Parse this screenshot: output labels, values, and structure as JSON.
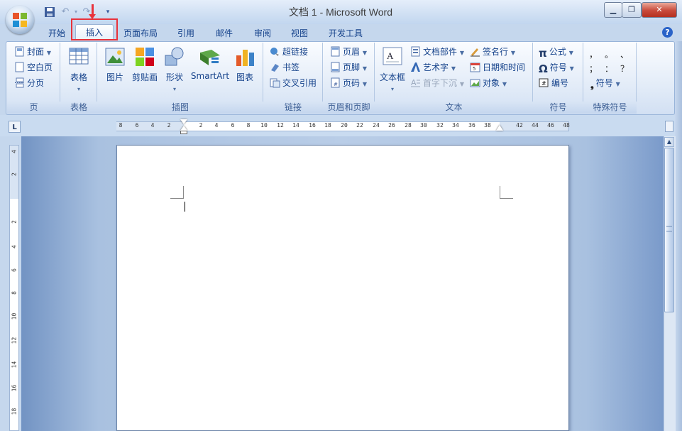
{
  "window": {
    "title": "文档 1 - Microsoft Word",
    "minimize": "▁",
    "restore": "❐",
    "close": "✕"
  },
  "quick_access": {
    "save_icon": "save-icon",
    "undo_icon": "undo-icon",
    "redo_icon": "redo-icon",
    "customize_icon": "customize-qat-icon"
  },
  "tabs": [
    "开始",
    "插入",
    "页面布局",
    "引用",
    "邮件",
    "审阅",
    "视图",
    "开发工具"
  ],
  "active_tab": "插入",
  "help": "?",
  "ribbon": {
    "pages": {
      "label": "页",
      "items": [
        "封面",
        "空白页",
        "分页"
      ]
    },
    "tables": {
      "label": "表格",
      "button": "表格"
    },
    "illustrations": {
      "label": "插图",
      "items": [
        "图片",
        "剪贴画",
        "形状",
        "SmartArt",
        "图表"
      ]
    },
    "links": {
      "label": "链接",
      "items": [
        "超链接",
        "书签",
        "交叉引用"
      ]
    },
    "header_footer": {
      "label": "页眉和页脚",
      "items": [
        "页眉",
        "页脚",
        "页码"
      ]
    },
    "text": {
      "label": "文本",
      "textbox": "文本框",
      "items": [
        "文档部件",
        "艺术字",
        "首字下沉",
        "签名行",
        "日期和时间",
        "对象"
      ]
    },
    "symbols": {
      "label": "符号",
      "items": [
        "公式",
        "符号",
        "编号"
      ]
    },
    "special_symbols": {
      "label": "特殊符号",
      "chars": [
        "，",
        "。",
        "、",
        "；",
        "：",
        "？"
      ],
      "button": "符号"
    }
  },
  "ruler": {
    "tab_selector": "L",
    "horizontal_ticks": [
      "8",
      "6",
      "4",
      "2",
      "2",
      "4",
      "6",
      "8",
      "10",
      "12",
      "14",
      "16",
      "18",
      "20",
      "22",
      "24",
      "26",
      "28",
      "30",
      "32",
      "34",
      "36",
      "38",
      "42",
      "44",
      "46",
      "48"
    ],
    "vertical_ticks": [
      "4",
      "2",
      "2",
      "4",
      "6",
      "8",
      "10",
      "12",
      "14",
      "16",
      "18"
    ]
  },
  "colors": {
    "tab_text": "#15428b",
    "highlight": "#e8323b"
  }
}
